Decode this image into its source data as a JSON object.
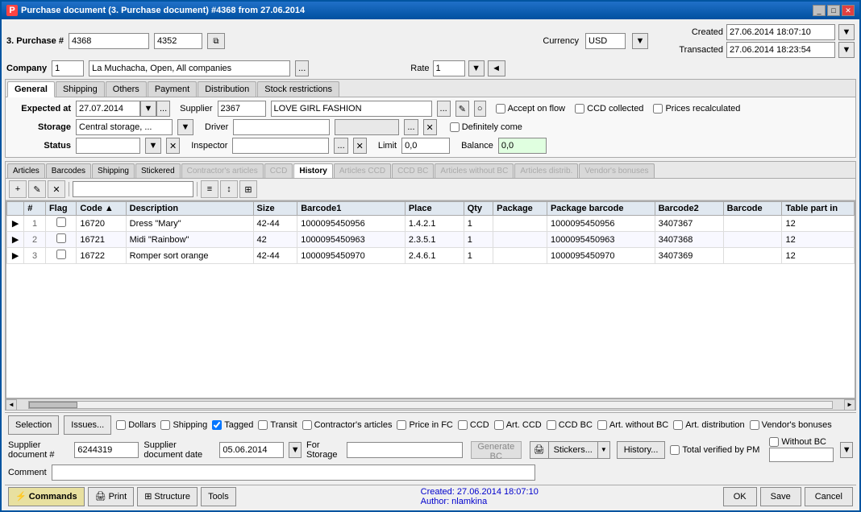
{
  "window": {
    "title": "Purchase document (3. Purchase document) #4368 from 27.06.2014",
    "title_icon": "P"
  },
  "header": {
    "purchase_label": "3. Purchase #",
    "purchase_num1": "4368",
    "purchase_num2": "4352",
    "company_label": "Company",
    "company_num": "1",
    "company_name": "La Muchacha, Open, All companies",
    "currency_label": "Currency",
    "currency_value": "USD",
    "rate_label": "Rate",
    "rate_value": "1",
    "created_label": "Created",
    "created_value": "27.06.2014 18:07:10",
    "transacted_label": "Transacted",
    "transacted_value": "27.06.2014 18:23:54"
  },
  "general_tab": {
    "expected_at_label": "Expected at",
    "expected_at_value": "27.07.2014",
    "supplier_label": "Supplier",
    "supplier_num": "2367",
    "supplier_name": "LOVE GIRL FASHION",
    "accept_on_flow": "Accept on flow",
    "ccd_collected": "CCD collected",
    "prices_recalculated": "Prices recalculated",
    "storage_label": "Storage",
    "storage_value": "Central storage, ...",
    "driver_label": "Driver",
    "definitely_come": "Definitely come",
    "status_label": "Status",
    "inspector_label": "Inspector",
    "limit_label": "Limit",
    "limit_value": "0,0",
    "balance_label": "Balance",
    "balance_value": "0,0"
  },
  "tabs": {
    "main_tabs": [
      "General",
      "Shipping",
      "Others",
      "Payment",
      "Distribution",
      "Stock restrictions"
    ],
    "active_main_tab": "General",
    "article_tabs": [
      "Articles",
      "Barcodes",
      "Shipping",
      "Stickered",
      "Contractor's articles",
      "CCD",
      "History",
      "Articles CCD",
      "CCD BC",
      "Articles without BC",
      "Articles distrib.",
      "Vendor's bonuses"
    ],
    "active_article_tab": "History"
  },
  "table": {
    "columns": [
      "",
      "",
      "Flag",
      "Code",
      "",
      "Description",
      "Size",
      "Barcode1",
      "Place",
      "Qty",
      "Package",
      "Package barcode",
      "Barcode2",
      "Barcode",
      "Table part in"
    ],
    "rows": [
      {
        "num": "1",
        "flag": false,
        "code": "16720",
        "description": "Dress \"Mary\"",
        "size": "42-44",
        "barcode1": "1000095450956",
        "place": "1.4.2.1",
        "qty": "1",
        "package": "",
        "package_barcode": "1000095450956",
        "barcode2": "3407367",
        "table_part_in": "12"
      },
      {
        "num": "2",
        "flag": false,
        "code": "16721",
        "description": "Midi \"Rainbow\"",
        "size": "42",
        "barcode1": "1000095450963",
        "place": "2.3.5.1",
        "qty": "1",
        "package": "",
        "package_barcode": "1000095450963",
        "barcode2": "3407368",
        "table_part_in": "12"
      },
      {
        "num": "3",
        "flag": false,
        "code": "16722",
        "description": "Romper sort orange",
        "size": "42-44",
        "barcode1": "1000095450970",
        "place": "2.4.6.1",
        "qty": "1",
        "package": "",
        "package_barcode": "1000095450970",
        "barcode2": "3407369",
        "table_part_in": "12"
      }
    ]
  },
  "bottom": {
    "selection_label": "Selection",
    "issues_label": "Issues...",
    "dollars": "Dollars",
    "shipping": "Shipping",
    "tagged": "Tagged",
    "tagged_checked": true,
    "transit": "Transit",
    "contractors_articles": "Contractor's articles",
    "price_in_fc": "Price in FC",
    "ccd": "CCD",
    "art_ccd": "Art. CCD",
    "ccd_bc": "CCD BC",
    "art_without_bc": "Art. without BC",
    "art_distribution": "Art. distribution",
    "vendor_bonuses": "Vendor's bonuses",
    "supplier_doc_label": "Supplier document #",
    "supplier_doc_value": "6244319",
    "supplier_doc_date_label": "Supplier document date",
    "supplier_doc_date_value": "05.06.2014",
    "for_storage_label": "For Storage",
    "generate_bc_label": "Generate BC",
    "stickers_label": "Stickers...",
    "history_label": "History...",
    "total_verified": "Total verified by PM",
    "without_bc": "Without BC",
    "comment_label": "Comment"
  },
  "statusbar": {
    "commands_label": "Commands",
    "print_label": "Print",
    "structure_label": "Structure",
    "tools_label": "Tools",
    "created_text": "Created: 27.06.2014 18:07:10",
    "author_text": "Author:  nlamkina",
    "ok_label": "OK",
    "save_label": "Save",
    "cancel_label": "Cancel"
  },
  "icons": {
    "lightning": "⚡",
    "printer": "🖨",
    "structure": "⊞",
    "wrench": "🔧",
    "sticker": "🖨",
    "copy": "⧉",
    "edit": "✎",
    "clear": "○",
    "close_x": "✕",
    "arrow_down": "▼",
    "arrow_left": "◄",
    "arrow_right": "►",
    "arrow_up": "▲",
    "dots": "...",
    "new_row": "+",
    "edit_row": "✎",
    "del_row": "✕"
  }
}
